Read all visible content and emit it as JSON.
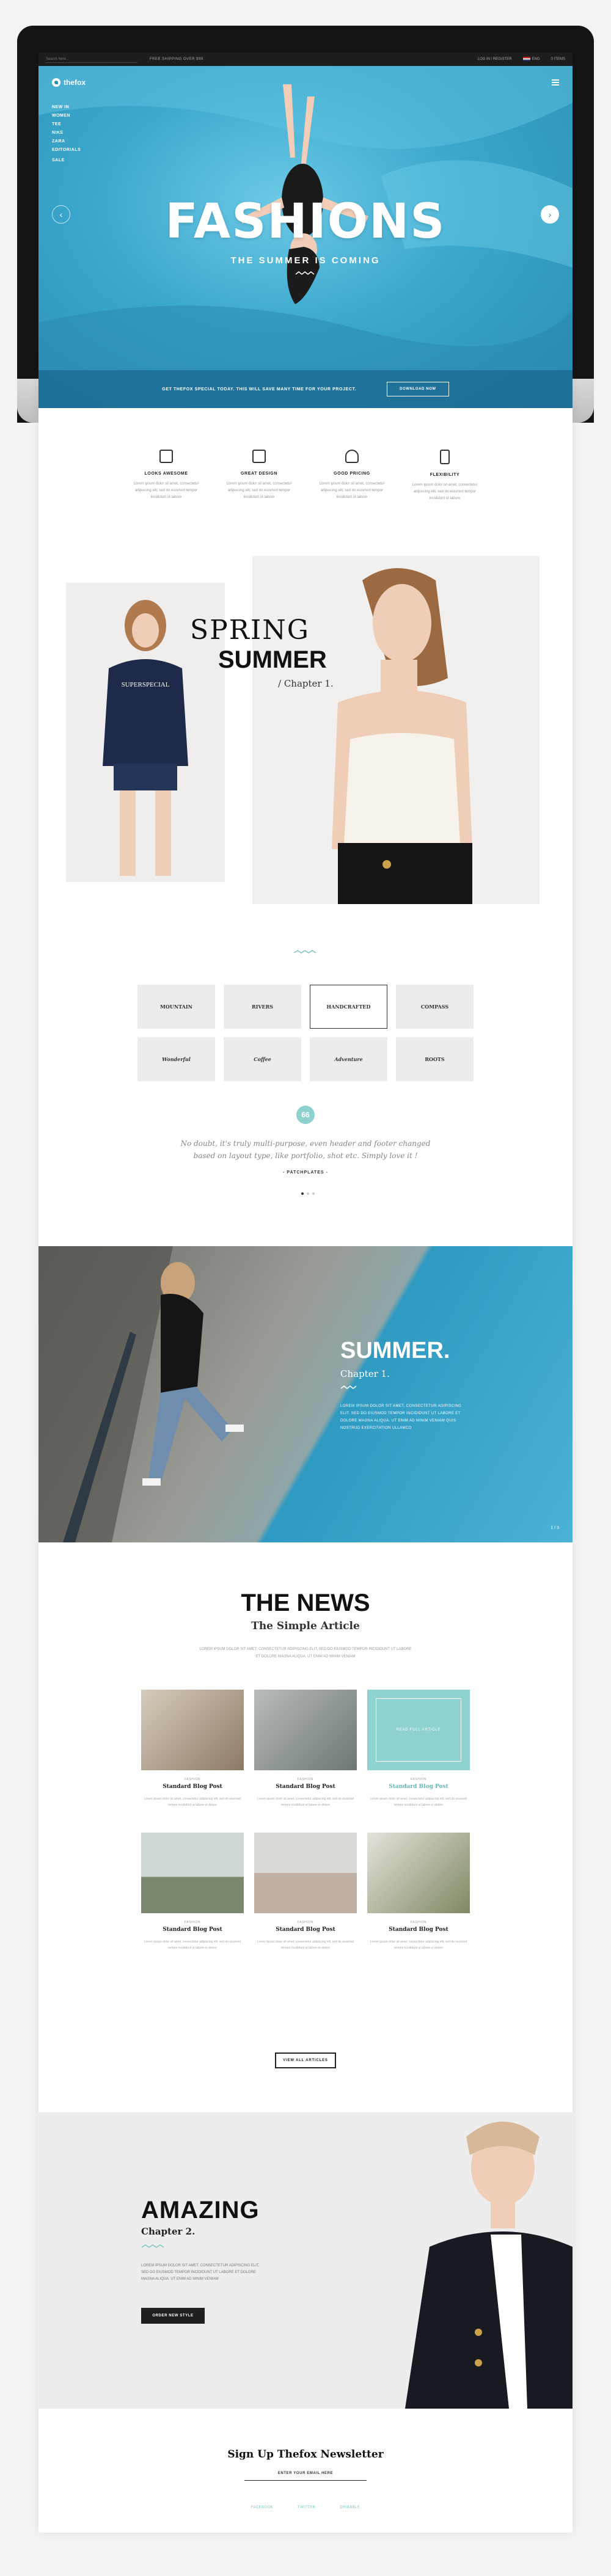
{
  "topbar": {
    "search_placeholder": "Search here...",
    "promo": "FREE SHIPPING OVER $99",
    "account": "LOG IN / REGISTER",
    "language": "ENG",
    "cart": "0 ITEMS"
  },
  "header": {
    "logo": "thefox",
    "nav": [
      "New In",
      "Women",
      "Tee",
      "Nike",
      "Zara",
      "Editorials"
    ],
    "nav_extra": "Sale"
  },
  "hero": {
    "title": "FASHIONS",
    "subtitle": "THE SUMMER IS COMING",
    "band_text": "GET THEFOX SPECIAL TODAY. THIS WILL SAVE MANY TIME FOR YOUR PROJECT.",
    "band_button": "DOWNLOAD NOW",
    "colors": {
      "water": "#3ba7cc"
    }
  },
  "features": [
    {
      "icon": "laptop-icon",
      "title": "LOOKS AWESOME",
      "text": "Lorem ipsum dolor sit amet, consectetur adipiscing elit, sed do eiusmod tempor incididunt ut labore"
    },
    {
      "icon": "bookmark-icon",
      "title": "GREAT DESIGN",
      "text": "Lorem ipsum dolor sit amet, consectetur adipiscing elit, sed do eiusmod tempor incididunt ut labore"
    },
    {
      "icon": "mug-icon",
      "title": "GOOD PRICING",
      "text": "Lorem ipsum dolor sit amet, consectetur adipiscing elit, sed do eiusmod tempor incididunt ut labore"
    },
    {
      "icon": "mobile-icon",
      "title": "FLEXIBILITY",
      "text": "Lorem ipsum dolor sit amet, consectetur adipiscing elit, sed do eiusmod tempor incididunt ut labore"
    }
  ],
  "collection": {
    "line1": "SPRING",
    "line2": "SUMMER",
    "chapter": "/ Chapter 1."
  },
  "brands": [
    "MOUNTAIN",
    "RIVERS",
    "HANDCRAFTED",
    "COMPASS",
    "Wonderful",
    "Coffee",
    "Adventure",
    "ROOTS"
  ],
  "testimonial": {
    "badge": "66",
    "quote_line1": "No doubt, it's truly multi-purpose, even header and footer changed",
    "quote_line2": "based on layout type, like portfolio, shot etc. Simply love it !",
    "author": "- PATCHPLATES -"
  },
  "summer": {
    "title": "SUMMER.",
    "chapter": "Chapter 1.",
    "text": "LOREM IPSUM DOLOR SIT AMET, CONSECTETUR ADIPISCING ELIT. SED DO EIUSMOD TEMPOR INCIDIDUNT UT LABORE ET DOLORE MAGNA ALIQUA. UT ENIM AD MINIM VENIAM QUIS NOSTRUD EXERCITATION ULLAMCO",
    "pager": "1 / 3"
  },
  "news": {
    "title": "THE NEWS",
    "subtitle": "The Simple Article",
    "desc": "LOREM IPSUM DOLOR SIT AMET, CONSECTETUR ADIPISCING ELIT, SED DO EIUSMOD TEMPOR INCIDIDUNT UT LABORE ET DOLORE MAGNA ALIQUA. UT ENIM AD MINIM VENIAM",
    "posts": [
      {
        "cat": "FASHION",
        "title": "Standard Blog Post",
        "text": "Lorem ipsum dolor sit amet, consectetur adipiscing elit, sed do eiusmod tempor incididunt ut labore et dolore",
        "color": "#b9a28a",
        "teal": false
      },
      {
        "cat": "FASHION",
        "title": "Standard Blog Post",
        "text": "Lorem ipsum dolor sit amet, consectetur adipiscing elit, sed do eiusmod tempor incididunt ut labore et dolore",
        "color": "#8f9898",
        "teal": false
      },
      {
        "cat": "FASHION",
        "title": "Standard Blog Post",
        "text": "Lorem ipsum dolor sit amet, consectetur adipiscing elit, sed do eiusmod tempor incididunt ut labore et dolore",
        "color": "#8fd1cf",
        "teal": true,
        "overlay": "READ FULL ARTICLE"
      },
      {
        "cat": "FASHION",
        "title": "Standard Blog Post",
        "text": "Lorem ipsum dolor sit amet, consectetur adipiscing elit, sed do eiusmod tempor incididunt ut labore et dolore",
        "color": "#7b8a86",
        "teal": false
      },
      {
        "cat": "FASHION",
        "title": "Standard Blog Post",
        "text": "Lorem ipsum dolor sit amet, consectetur adipiscing elit, sed do eiusmod tempor incididunt ut labore et dolore",
        "color": "#c8bcb0",
        "teal": false
      },
      {
        "cat": "FASHION",
        "title": "Standard Blog Post",
        "text": "Lorem ipsum dolor sit amet, consectetur adipiscing elit, sed do eiusmod tempor incididunt ut labore et dolore",
        "color": "#a3a89a",
        "teal": false
      }
    ],
    "view_all": "VIEW ALL ARTICLES"
  },
  "amazing": {
    "title": "AMAZING",
    "chapter": "Chapter 2.",
    "text": "LOREM IPSUM DOLOR SIT AMET, CONSECTETUR ADIPISCING ELIT, SED DO EIUSMOD TEMPOR INCIDIDUNT UT LABORE ET DOLORE MAGNA ALIQUA. UT ENIM AD MINIM VENIAM",
    "button": "ORDER NEW STYLE"
  },
  "newsletter": {
    "title": "Sign Up Thefox Newsletter",
    "input_placeholder": "ENTER YOUR EMAIL HERE",
    "links": [
      "FACEBOOK",
      "TWITTER",
      "DRIBBBLE"
    ]
  },
  "accent": "#7cc5c3"
}
